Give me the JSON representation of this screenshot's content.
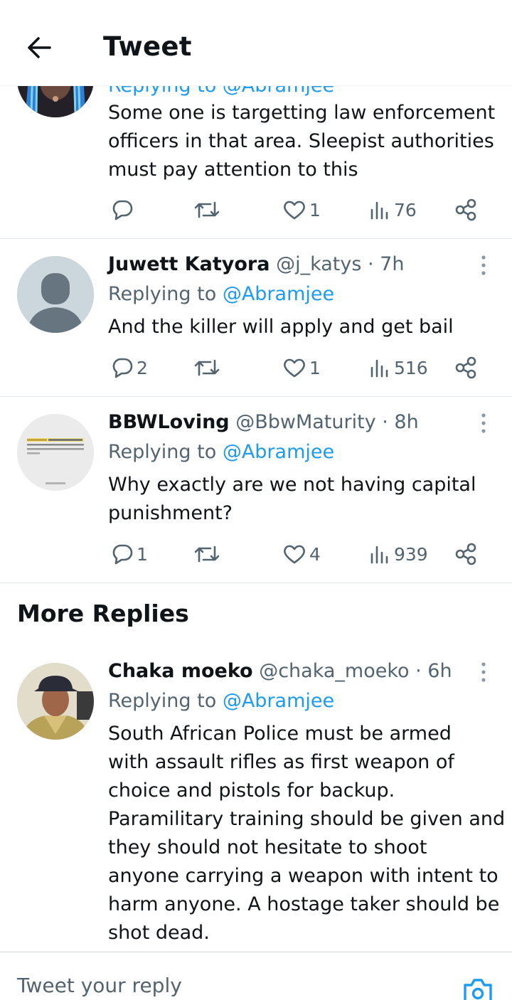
{
  "header": {
    "title": "Tweet",
    "back_icon": "arrow-left-icon"
  },
  "tweets": [
    {
      "avatar": "avatar-photo-blue-braids",
      "replying_partial": "Replying to @Abramjee",
      "text_lines": [
        "Some one is targetting law enforcement",
        "officers in that area. Sleepist authorities",
        "must pay attention to this"
      ],
      "replies": "",
      "retweets": "",
      "likes": "1",
      "views": "76"
    },
    {
      "avatar": "default-avatar",
      "name": "Juwett Katyora",
      "handle": "@j_katys",
      "time": "· 7h",
      "replying_label": "Replying to",
      "replying_to": "@Abramjee",
      "text_lines": [
        "And the killer will apply and get bail"
      ],
      "replies": "2",
      "retweets": "",
      "likes": "1",
      "views": "516"
    },
    {
      "avatar": "avatar-quote-image",
      "avatar_text": "Five types of people you should surround yourself with: the trusted, the passionate, the motivated, the grateful and the open minded",
      "name": "BBWLoving",
      "handle": "@BbwMaturity",
      "time": "· 8h",
      "replying_label": "Replying to",
      "replying_to": "@Abramjee",
      "text_lines": [
        "Why exactly are we not having capital",
        "punishment?"
      ],
      "replies": "1",
      "retweets": "",
      "likes": "4",
      "views": "939"
    }
  ],
  "more_replies": {
    "title": "More Replies",
    "tweet": {
      "avatar": "avatar-photo-man-cap",
      "name": "Chaka moeko",
      "handle": "@chaka_moeko",
      "time": "· 6h",
      "replying_label": "Replying to",
      "replying_to": "@Abramjee",
      "text_lines": [
        "South African Police must be armed",
        "with assault rifles as first weapon of",
        "choice and pistols for backup.",
        "Paramilitary training should be given and",
        "they should not hesitate to shoot",
        "anyone carrying a weapon with intent to",
        "harm anyone. A hostage taker should be",
        "shot dead."
      ]
    }
  },
  "compose": {
    "placeholder": "Tweet your reply",
    "camera_icon": "camera-icon"
  },
  "colors": {
    "accent": "#1d9bf0",
    "muted": "#536471",
    "text": "#0f1419",
    "divider": "#e1e6ea"
  }
}
